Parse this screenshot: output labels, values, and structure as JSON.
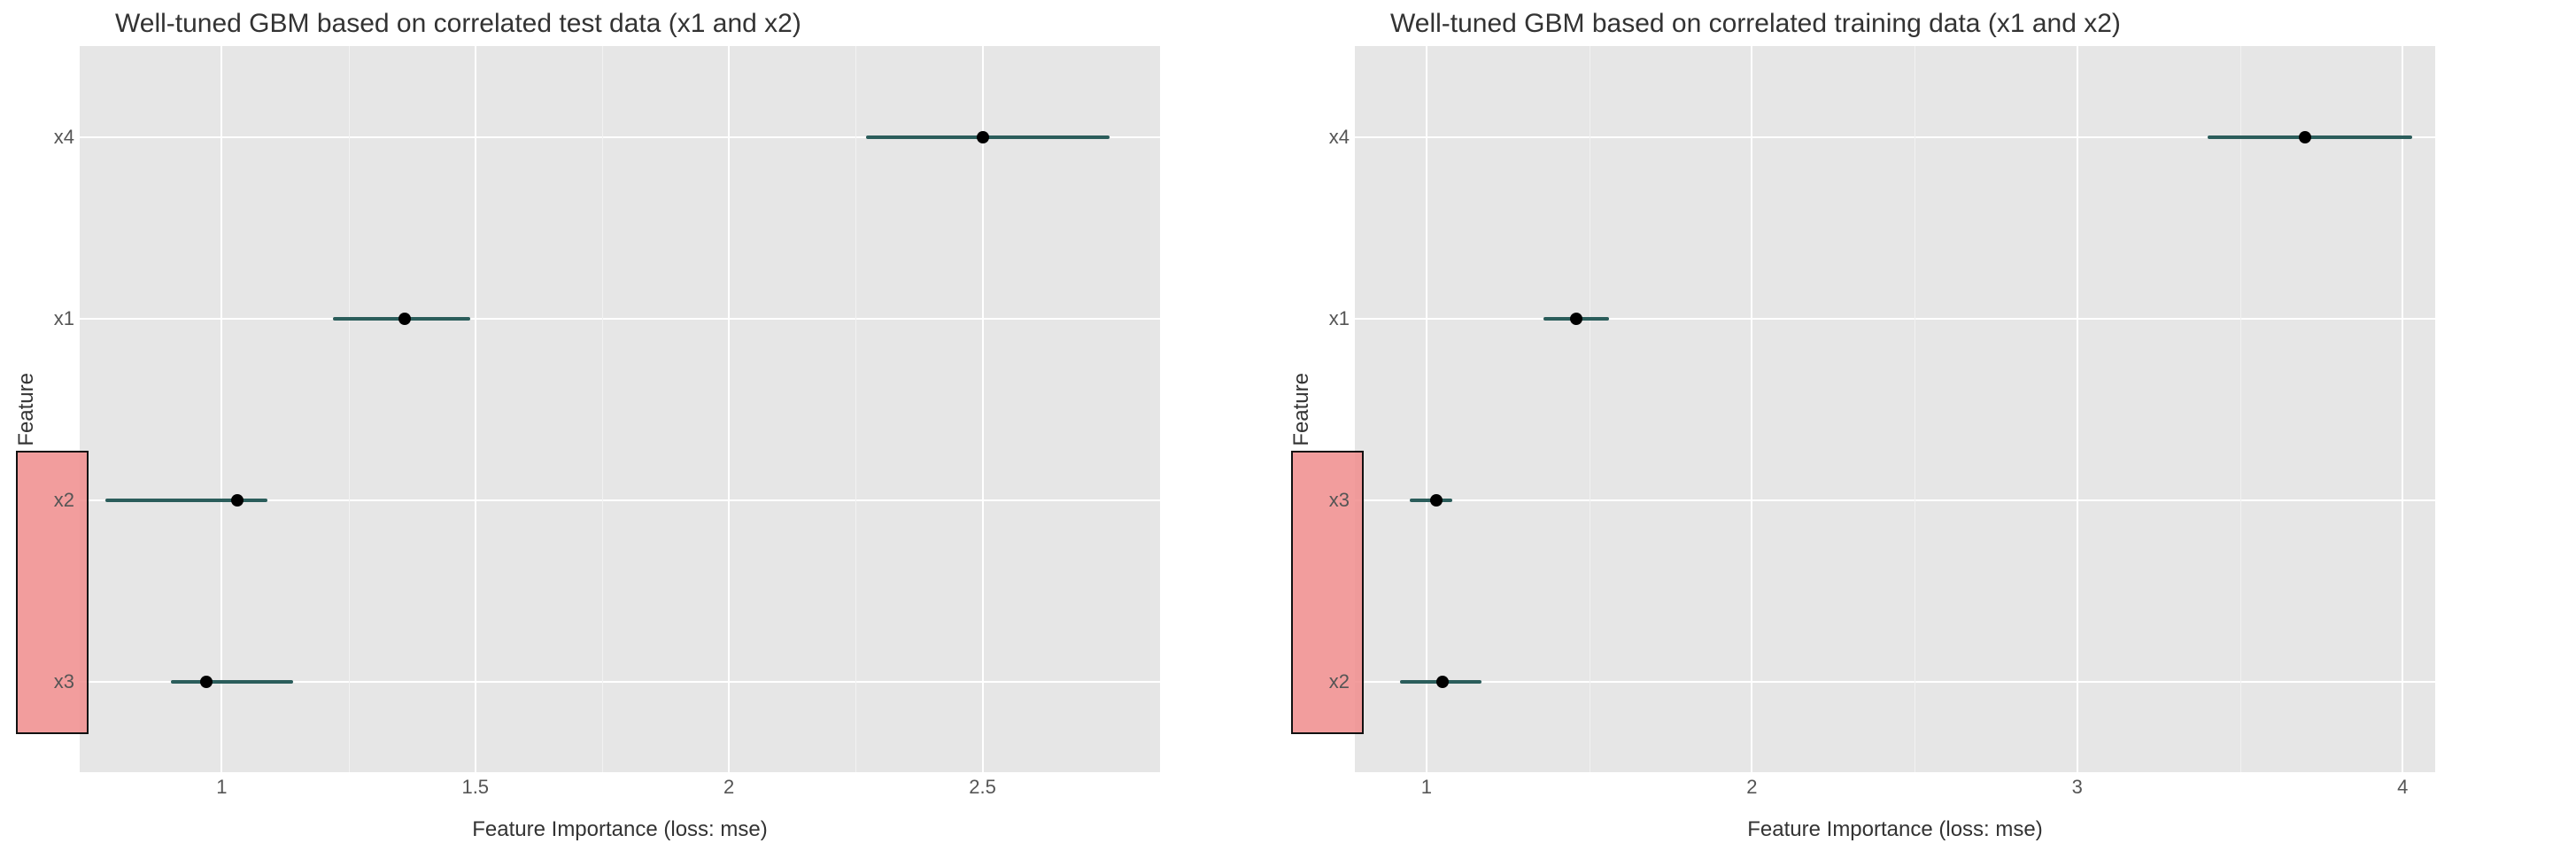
{
  "chart_data": [
    {
      "type": "dotplot",
      "title": "Well-tuned GBM based on correlated test data (x1 and x2)",
      "xlabel": "Feature Importance (loss: mse)",
      "ylabel": "Feature",
      "xlim": [
        0.72,
        2.85
      ],
      "x_ticks": [
        1.0,
        1.5,
        2.0,
        2.5
      ],
      "categories": [
        "x4",
        "x1",
        "x2",
        "x3"
      ],
      "series": [
        {
          "name": "x4",
          "value": 2.5,
          "low": 2.27,
          "high": 2.75
        },
        {
          "name": "x1",
          "value": 1.36,
          "low": 1.22,
          "high": 1.49
        },
        {
          "name": "x2",
          "value": 1.03,
          "low": 0.77,
          "high": 1.09
        },
        {
          "name": "x3",
          "value": 0.97,
          "low": 0.9,
          "high": 1.14
        }
      ],
      "highlighted": [
        "x2",
        "x3"
      ]
    },
    {
      "type": "dotplot",
      "title": "Well-tuned GBM based on correlated training data (x1 and x2)",
      "xlabel": "Feature Importance (loss: mse)",
      "ylabel": "Feature",
      "xlim": [
        0.78,
        4.1
      ],
      "x_ticks": [
        1,
        2,
        3,
        4
      ],
      "categories": [
        "x4",
        "x1",
        "x3",
        "x2"
      ],
      "series": [
        {
          "name": "x4",
          "value": 3.7,
          "low": 3.4,
          "high": 4.03
        },
        {
          "name": "x1",
          "value": 1.46,
          "low": 1.36,
          "high": 1.56
        },
        {
          "name": "x3",
          "value": 1.03,
          "low": 0.95,
          "high": 1.08
        },
        {
          "name": "x2",
          "value": 1.05,
          "low": 0.92,
          "high": 1.17
        }
      ],
      "highlighted": [
        "x3",
        "x2"
      ]
    }
  ],
  "colors": {
    "panel_bg": "#e6e6e6",
    "grid": "#ffffff",
    "segment": "#2b5d5b",
    "point": "#000000",
    "highlight_fill": "#f1a3a3",
    "highlight_stroke": "#111111"
  }
}
